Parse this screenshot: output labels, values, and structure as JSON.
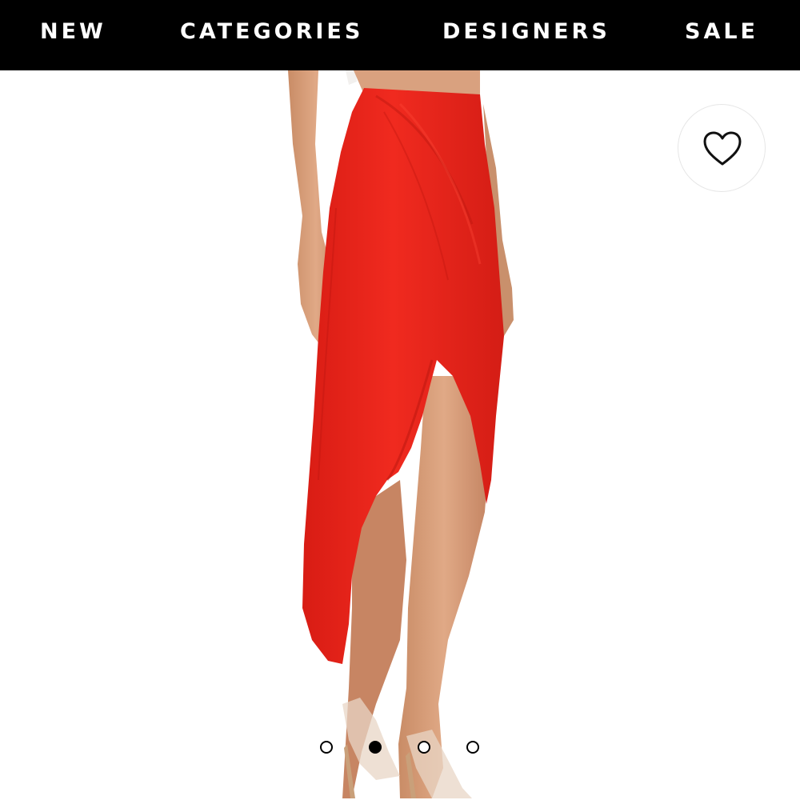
{
  "nav": {
    "items": [
      {
        "label": "NEW"
      },
      {
        "label": "CATEGORIES"
      },
      {
        "label": "DESIGNERS"
      },
      {
        "label": "SALE"
      }
    ]
  },
  "product": {
    "color": "#e8241b",
    "favorite_icon": "heart-outline-icon"
  },
  "carousel": {
    "total_slides": 4,
    "active_index": 2
  },
  "colors": {
    "nav_background": "#000000",
    "nav_text": "#ffffff",
    "skirt": "#e8241b"
  }
}
